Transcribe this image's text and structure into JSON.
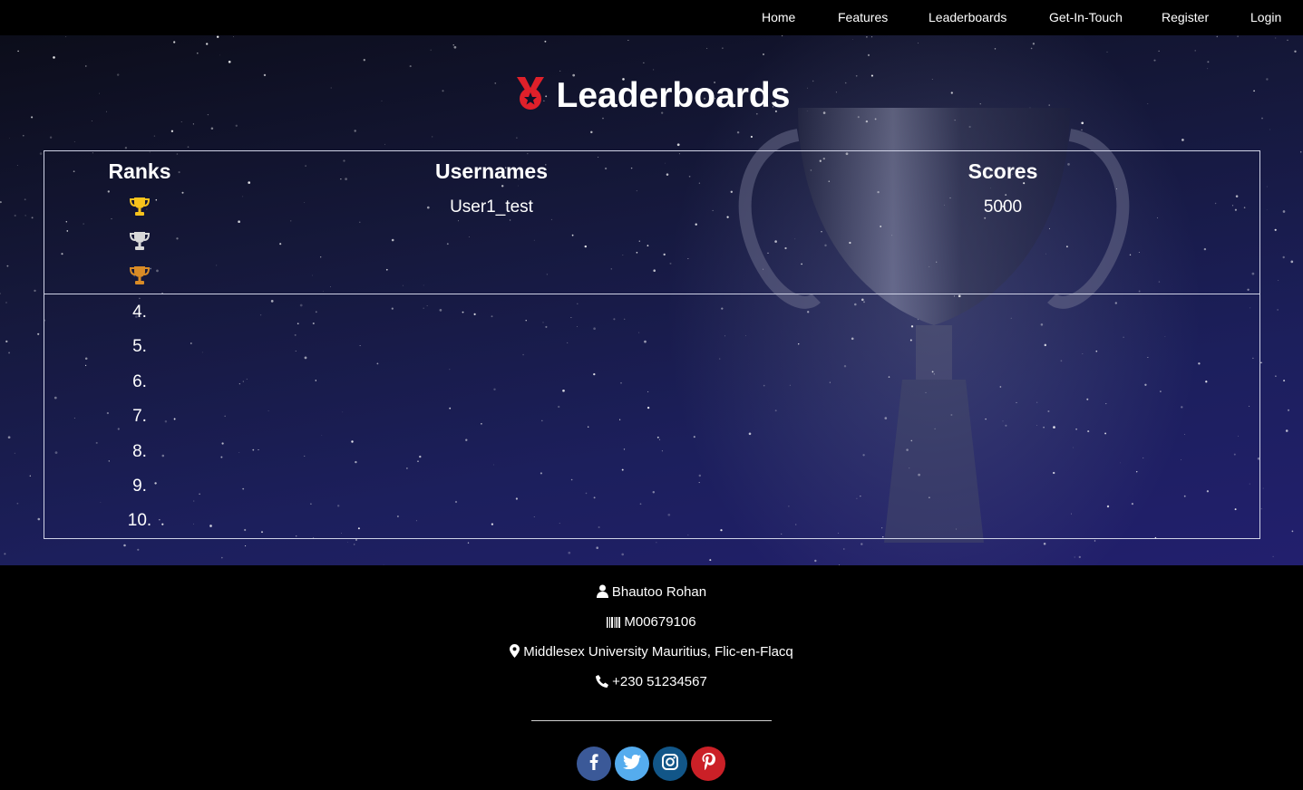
{
  "nav": {
    "items": [
      {
        "label": "Home"
      },
      {
        "label": "Features"
      },
      {
        "label": "Leaderboards"
      },
      {
        "label": "Get-In-Touch"
      },
      {
        "label": "Register"
      },
      {
        "label": "Login"
      }
    ]
  },
  "page": {
    "title": "Leaderboards",
    "title_icon": "medal-icon"
  },
  "leaderboard": {
    "headers": {
      "rank": "Ranks",
      "username": "Usernames",
      "score": "Scores"
    },
    "top3": [
      {
        "rank_icon": "trophy-gold-icon",
        "color": "#f7c21c",
        "username": "User1_test",
        "score": "5000"
      },
      {
        "rank_icon": "trophy-silver-icon",
        "color": "#d9d9d9",
        "username": "",
        "score": ""
      },
      {
        "rank_icon": "trophy-bronze-icon",
        "color": "#d98b26",
        "username": "",
        "score": ""
      }
    ],
    "ranks": [
      "4.",
      "5.",
      "6.",
      "7.",
      "8.",
      "9.",
      "10."
    ]
  },
  "footer": {
    "name": "Bhautoo Rohan",
    "student_id": "M00679106",
    "address": "Middlesex University Mauritius, Flic-en-Flacq",
    "phone": "+230 51234567",
    "socials": [
      {
        "icon": "facebook-icon",
        "color": "#3b5998"
      },
      {
        "icon": "twitter-icon",
        "color": "#55acee"
      },
      {
        "icon": "instagram-icon",
        "color": "#125688"
      },
      {
        "icon": "pinterest-icon",
        "color": "#cb2027"
      }
    ]
  },
  "colors": {
    "accent_red": "#e0202a",
    "table_border": "#cfd2e6"
  }
}
